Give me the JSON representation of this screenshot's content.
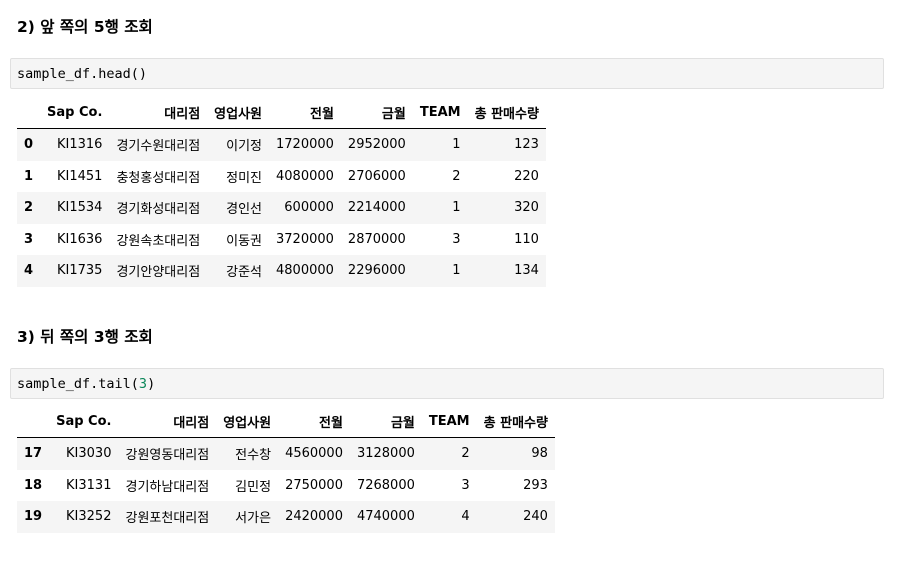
{
  "sections": [
    {
      "heading": "2) 앞 쪽의 5행 조회",
      "code_prefix": "sample_df.head(",
      "code_arg": "",
      "code_suffix": ")",
      "columns": [
        "",
        "Sap Co.",
        "대리점",
        "영업사원",
        "전월",
        "금월",
        "TEAM",
        "총 판매수량"
      ],
      "rows": [
        [
          "0",
          "KI1316",
          "경기수원대리점",
          "이기정",
          "1720000",
          "2952000",
          "1",
          "123"
        ],
        [
          "1",
          "KI1451",
          "충청홍성대리점",
          "정미진",
          "4080000",
          "2706000",
          "2",
          "220"
        ],
        [
          "2",
          "KI1534",
          "경기화성대리점",
          "경인선",
          "600000",
          "2214000",
          "1",
          "320"
        ],
        [
          "3",
          "KI1636",
          "강원속초대리점",
          "이동권",
          "3720000",
          "2870000",
          "3",
          "110"
        ],
        [
          "4",
          "KI1735",
          "경기안양대리점",
          "강준석",
          "4800000",
          "2296000",
          "1",
          "134"
        ]
      ]
    },
    {
      "heading": "3) 뒤 쪽의 3행 조회",
      "code_prefix": "sample_df.tail(",
      "code_arg": "3",
      "code_suffix": ")",
      "columns": [
        "",
        "Sap Co.",
        "대리점",
        "영업사원",
        "전월",
        "금월",
        "TEAM",
        "총 판매수량"
      ],
      "rows": [
        [
          "17",
          "KI3030",
          "강원영동대리점",
          "전수창",
          "4560000",
          "3128000",
          "2",
          "98"
        ],
        [
          "18",
          "KI3131",
          "경기하남대리점",
          "김민정",
          "2750000",
          "7268000",
          "3",
          "293"
        ],
        [
          "19",
          "KI3252",
          "강원포천대리점",
          "서가은",
          "2420000",
          "4740000",
          "4",
          "240"
        ]
      ]
    }
  ]
}
